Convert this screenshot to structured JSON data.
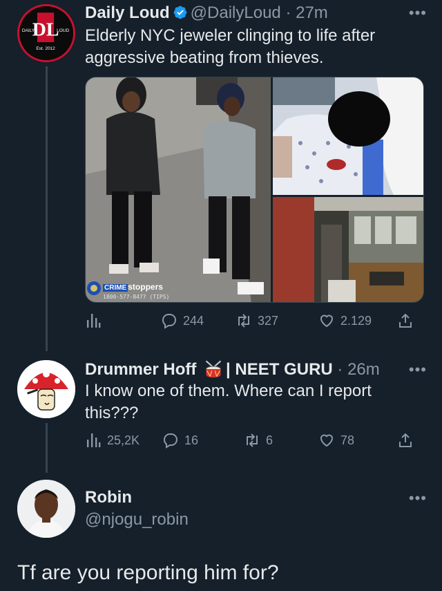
{
  "tweet1": {
    "display_name": "Daily Loud",
    "handle": "@DailyLoud",
    "time": "27m",
    "text_line1": "Elderly NYC jeweler clinging to life after",
    "text_line2": "aggressive beating from thieves.",
    "avatar": {
      "left": "DAILY",
      "right": "LOUD",
      "bottom": "Est. 2012",
      "mono": "DL"
    },
    "media_caption": "CRIME",
    "media_caption_suffix": "stoppers",
    "media_phone": "1800-577-8477 (TIPS)",
    "stats": {
      "replies": "244",
      "retweets": "327",
      "likes": "2.129"
    }
  },
  "tweet2": {
    "display_name": "Drummer Hoff",
    "name_suffix": "| NEET GURU",
    "time": "26m",
    "text_line1": "I know one of them. Where can I report",
    "text_line2": "this???",
    "stats": {
      "views": "25,2K",
      "replies": "16",
      "retweets": "6",
      "likes": "78"
    }
  },
  "tweet3": {
    "display_name": "Robin",
    "handle": "@njogu_robin",
    "text": "Tf are you reporting him for?"
  },
  "colors": {
    "background": "#15202b",
    "text": "#e7e9ea",
    "muted": "#8b98a5",
    "verified": "#1d9bf0",
    "brand_red": "#c8102e"
  },
  "icons": [
    "verified-badge-icon",
    "more-icon",
    "analytics-icon",
    "reply-icon",
    "retweet-icon",
    "like-icon",
    "share-icon",
    "drum-icon"
  ]
}
